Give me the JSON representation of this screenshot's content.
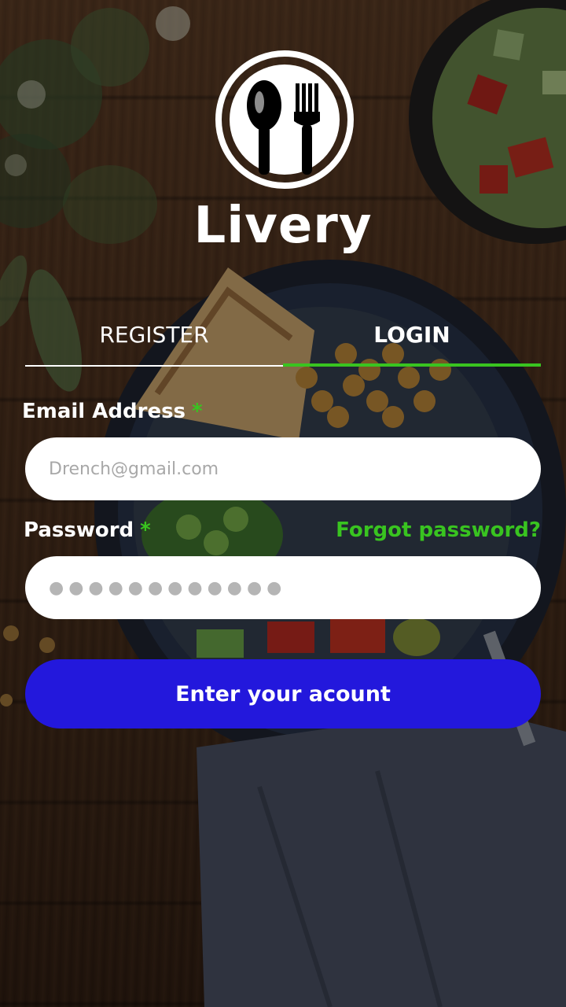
{
  "app": {
    "brand_name": "Livery",
    "logo_icon": "spoon-fork-icon"
  },
  "tabs": [
    {
      "label": "REGISTER",
      "active": false
    },
    {
      "label": "LOGIN",
      "active": true
    }
  ],
  "form": {
    "email": {
      "label": "Email Address",
      "required_mark": "*",
      "placeholder": "Drench@gmail.com",
      "value": ""
    },
    "password": {
      "label": "Password",
      "required_mark": "*",
      "masked_value": "●●●●●●●●●●●●",
      "forgot_link": "Forgot password?"
    },
    "submit_label": "Enter your acount"
  },
  "colors": {
    "accent_green": "#39c420",
    "button_blue": "#2318dc",
    "text_white": "#ffffff"
  }
}
